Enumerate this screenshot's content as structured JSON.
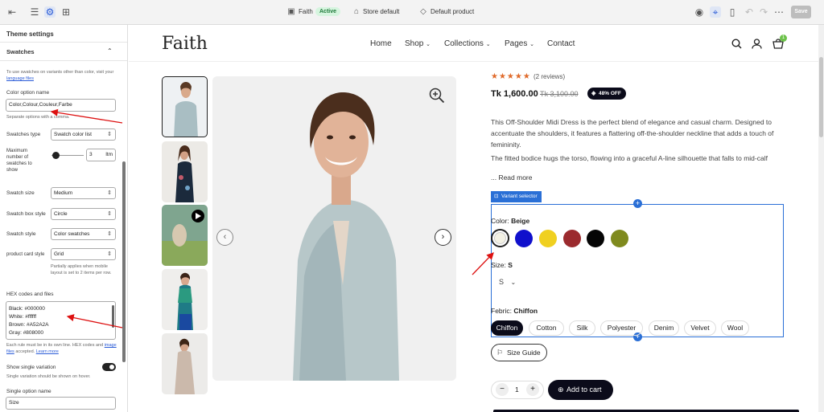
{
  "toolbar": {
    "theme_name": "Faith",
    "status": "Active",
    "store": "Store default",
    "product": "Default product",
    "save": "Save"
  },
  "sidebar": {
    "title": "Theme settings",
    "section": "Swatches",
    "intro": "To use swatches on variants other than color, visit your",
    "intro_link": "language files",
    "color_option_label": "Color option name",
    "color_option_value": "Color,Colour,Couleur,Farbe",
    "color_option_help": "Separate options with a comma.",
    "swatches_type_label": "Swatches type",
    "swatches_type_value": "Swatch color list",
    "max_swatches_label": "Maximum number of swatches to show",
    "max_swatches_value": "3",
    "max_swatches_unit": "ltm",
    "swatch_size_label": "Swatch size",
    "swatch_size_value": "Medium",
    "box_style_label": "Swatch box style",
    "box_style_value": "Circle",
    "swatch_style_label": "Swatch style",
    "swatch_style_value": "Color swatches",
    "card_style_label": "product card style",
    "card_style_value": "Grid",
    "card_style_help": "Partially applies when mobile layout is set to 2 items per row.",
    "hex_label": "HEX codes and files",
    "hex_lines": [
      "Black: #000000",
      "White: #ffffff",
      "Brown: #A52A2A",
      "Gray: #808000"
    ],
    "hex_help": "Each rule must be in its own line. HEX codes and",
    "hex_help_link1": "image files",
    "hex_help_mid": "accepted.",
    "hex_help_link2": "Learn more",
    "show_single_label": "Show single variation",
    "show_single_help": "Single variation should be shown on hover.",
    "single_option_label": "Single option name",
    "single_option_value": "Size"
  },
  "store": {
    "logo": "Faith",
    "nav": [
      "Home",
      "Shop",
      "Collections",
      "Pages",
      "Contact"
    ],
    "cart_count": "1"
  },
  "product": {
    "reviews": "(2 reviews)",
    "price": "Tk 1,600.00",
    "compare_price": "Tk 3,100.00",
    "discount": "48% OFF",
    "desc1": "This Off-Shoulder Midi Dress is the perfect blend of elegance and casual charm. Designed to accentuate the shoulders, it features a flattering off-the-shoulder neckline that adds a touch of femininity.",
    "desc2": "The fitted bodice hugs the torso, flowing into a graceful A-line silhouette that falls to mid-calf",
    "read_more": "... Read more",
    "variant_selector": "Variant selector",
    "color_label": "Color:",
    "color_value": "Beige",
    "swatch_colors": [
      "#f3f1e4",
      "#1010cc",
      "#f0d020",
      "#9b2a2e",
      "#050505",
      "#7f8a1e"
    ],
    "size_label": "Size:",
    "size_value": "S",
    "size_dropdown": "S",
    "fabric_label": "Febric:",
    "fabric_value": "Chiffon",
    "fabrics": [
      "Chiffon",
      "Cotton",
      "Silk",
      "Polyester",
      "Denim",
      "Velvet",
      "Wool"
    ],
    "size_guide": "Size Guide",
    "qty": "1",
    "add_to_cart": "Add to cart"
  }
}
